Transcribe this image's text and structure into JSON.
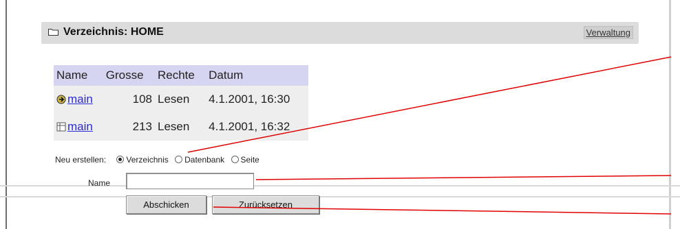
{
  "header": {
    "title": "Verzeichnis: HOME",
    "admin_link": "Verwaltung"
  },
  "table": {
    "columns": [
      "Name",
      "Grosse",
      "Rechte",
      "Datum"
    ],
    "rows": [
      {
        "icon": "folder-up-icon",
        "name": "main",
        "size": "108",
        "rights": "Lesen",
        "date": "4.1.2001, 16:30"
      },
      {
        "icon": "database-icon",
        "name": "main",
        "size": "213",
        "rights": "Lesen",
        "date": "4.1.2001, 16:32"
      }
    ]
  },
  "create": {
    "label": "Neu erstellen:",
    "options": [
      "Verzeichnis",
      "Datenbank",
      "Seite"
    ],
    "selected": "Verzeichnis"
  },
  "name_field": {
    "label": "Name",
    "value": ""
  },
  "buttons": {
    "submit": "Abschicken",
    "reset": "Zurücksetzen"
  },
  "colors": {
    "callout_line": "#e00000",
    "table_header_bg": "#d5d5f2",
    "link": "#2a2ad8"
  }
}
